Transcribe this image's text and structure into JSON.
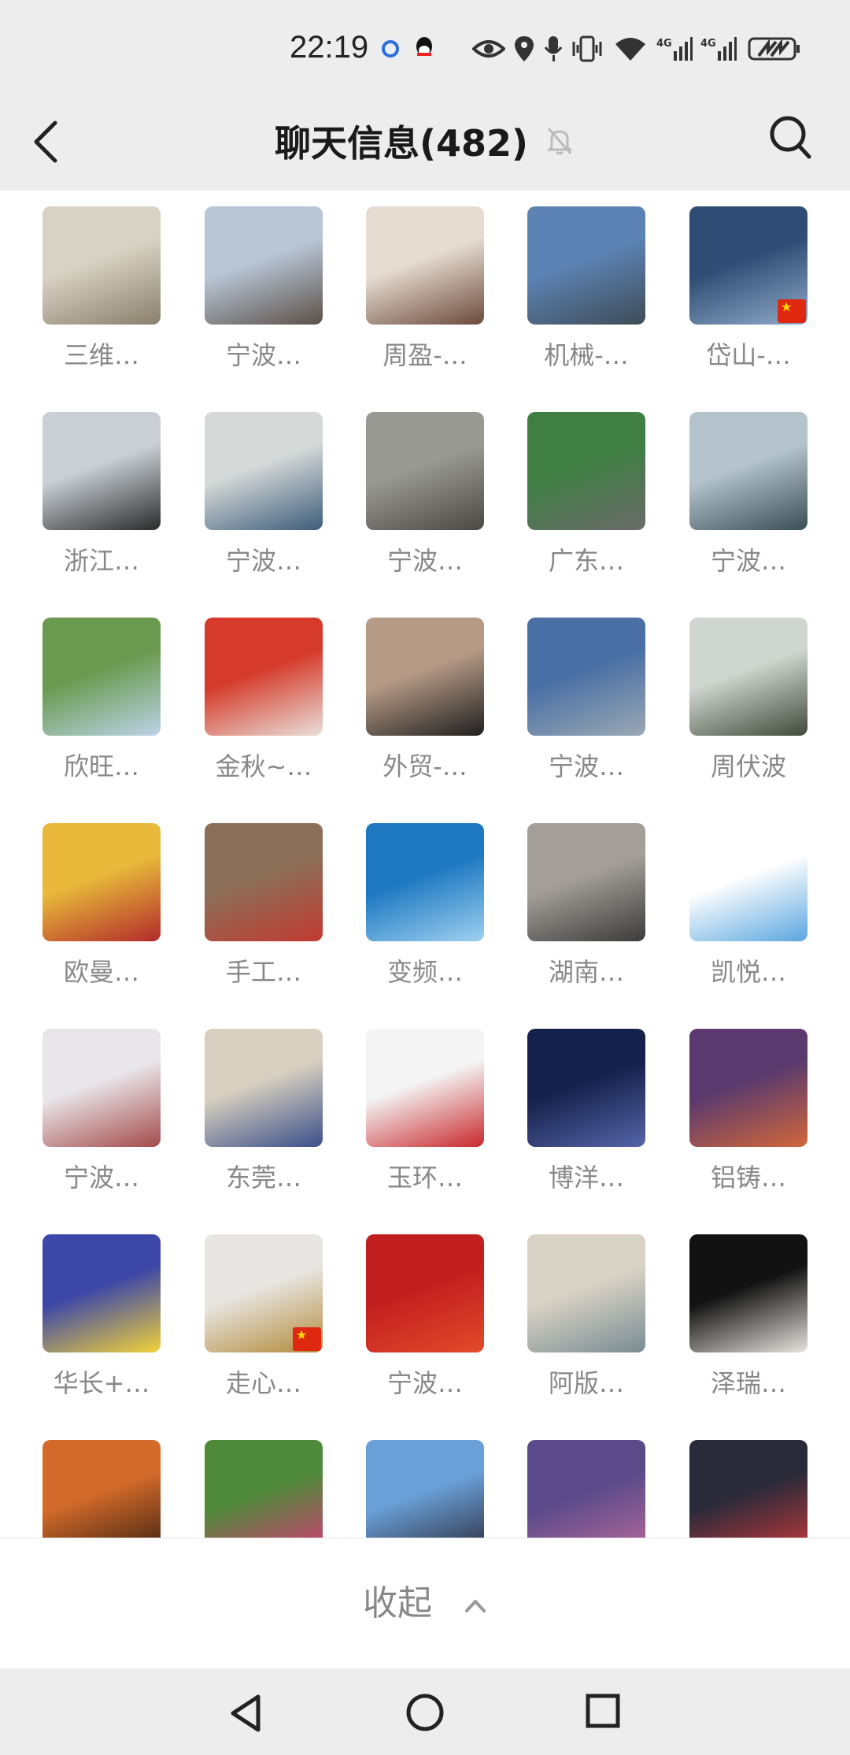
{
  "status_bar": {
    "time": "22:19",
    "icons": [
      "app-notification-icon",
      "qq-icon",
      "eye-icon",
      "location-icon",
      "mic-icon",
      "vibrate-icon",
      "wifi-icon",
      "signal-4g-icon",
      "signal-4g-icon",
      "battery-charging-icon"
    ]
  },
  "header": {
    "title": "聊天信息(482)",
    "icons": [
      "back-icon",
      "mute-bell-icon",
      "search-icon"
    ]
  },
  "members": [
    {
      "name": "三维…",
      "colors": [
        "#d8d2c4",
        "#8a7f6c"
      ]
    },
    {
      "name": "宁波…",
      "colors": [
        "#b9c6d6",
        "#5b5048"
      ]
    },
    {
      "name": "周盈-…",
      "colors": [
        "#e6dcd2",
        "#6b4a3a"
      ]
    },
    {
      "name": "机械-…",
      "colors": [
        "#5d83b4",
        "#3e4c57"
      ]
    },
    {
      "name": "岱山-…",
      "colors": [
        "#2f4d74",
        "#8fa9c8"
      ]
    },
    {
      "name": "浙江…",
      "colors": [
        "#c9cfd4",
        "#2a2a2a"
      ]
    },
    {
      "name": "宁波…",
      "colors": [
        "#d5d9d8",
        "#3d5c7a"
      ]
    },
    {
      "name": "宁波…",
      "colors": [
        "#9a9a94",
        "#4a4844"
      ]
    },
    {
      "name": "广东…",
      "colors": [
        "#3f7f43",
        "#6a6a6a"
      ]
    },
    {
      "name": "宁波…",
      "colors": [
        "#b4c3cc",
        "#3a4e55"
      ]
    },
    {
      "name": "欣旺…",
      "colors": [
        "#6a9a4f",
        "#bcd3e8"
      ]
    },
    {
      "name": "金秋~…",
      "colors": [
        "#d53a2a",
        "#e9e0da"
      ]
    },
    {
      "name": "外贸-…",
      "colors": [
        "#b59a86",
        "#1f1f1f"
      ]
    },
    {
      "name": "宁波…",
      "colors": [
        "#4a6fa5",
        "#9aa8b4"
      ]
    },
    {
      "name": "周伏波",
      "colors": [
        "#cfd6cf",
        "#3e4a3a"
      ]
    },
    {
      "name": "欧曼…",
      "colors": [
        "#e8b93a",
        "#b22a2a"
      ]
    },
    {
      "name": "手工…",
      "colors": [
        "#8b6f58",
        "#c23a32"
      ]
    },
    {
      "name": "变频…",
      "colors": [
        "#1e79c2",
        "#9ed0f0"
      ]
    },
    {
      "name": "湖南…",
      "colors": [
        "#a39f98",
        "#3b3b3b"
      ]
    },
    {
      "name": "凯悦…",
      "colors": [
        "#ffffff",
        "#5aa6e0"
      ]
    },
    {
      "name": "宁波…",
      "colors": [
        "#e9e6ea",
        "#a44a4a"
      ]
    },
    {
      "name": "东莞…",
      "colors": [
        "#d7cfbf",
        "#3a4f8a"
      ]
    },
    {
      "name": "玉环…",
      "colors": [
        "#f4f4f4",
        "#c8282c"
      ]
    },
    {
      "name": "博洋…",
      "colors": [
        "#14214a",
        "#5564a8"
      ]
    },
    {
      "name": "铝铸…",
      "colors": [
        "#5a3a6e",
        "#d2673a"
      ]
    },
    {
      "name": "华长+…",
      "colors": [
        "#3c47a8",
        "#f2d23a"
      ]
    },
    {
      "name": "走心…",
      "colors": [
        "#e8e6e2",
        "#b38a3a"
      ]
    },
    {
      "name": "宁波…",
      "colors": [
        "#c11f1f",
        "#e34a2a"
      ]
    },
    {
      "name": "阿版…",
      "colors": [
        "#d9d3c6",
        "#7a8c92"
      ]
    },
    {
      "name": "泽瑞…",
      "colors": [
        "#121212",
        "#e8e4e0"
      ]
    },
    {
      "name": "",
      "colors": [
        "#d36a2a",
        "#3a2010"
      ]
    },
    {
      "name": "",
      "colors": [
        "#4f8a3a",
        "#d83a7a"
      ]
    },
    {
      "name": "",
      "colors": [
        "#6aa0d8",
        "#2a2a3a"
      ]
    },
    {
      "name": "",
      "colors": [
        "#5a4a8a",
        "#b86a9a"
      ]
    },
    {
      "name": "",
      "colors": [
        "#2a2a3a",
        "#c83a3a"
      ]
    }
  ],
  "collapse": {
    "label": "收起"
  },
  "nav": {
    "icons": [
      "nav-back-icon",
      "nav-home-icon",
      "nav-recents-icon"
    ]
  }
}
